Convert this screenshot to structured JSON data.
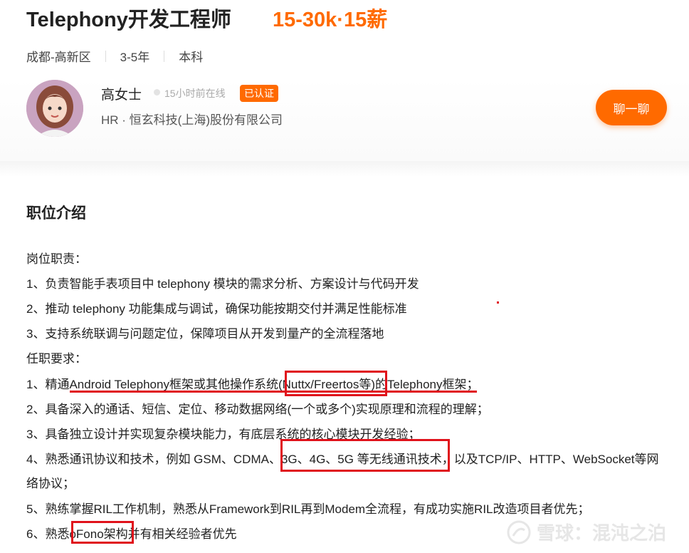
{
  "job": {
    "title": "Telephony开发工程师",
    "salary": "15-30k·15薪",
    "location": "成都-高新区",
    "experience": "3-5年",
    "education": "本科"
  },
  "recruiter": {
    "name": "高女士",
    "online_status": "15小时前在线",
    "verified_badge": "已认证",
    "company": "HR · 恒玄科技(上海)股份有限公司",
    "chat_button": "聊一聊"
  },
  "description": {
    "section_title": "职位介绍",
    "lines": [
      "岗位职责：",
      "1、负责智能手表项目中 telephony 模块的需求分析、方案设计与代码开发",
      "2、推动 telephony 功能集成与调试，确保功能按期交付并满足性能标准",
      "3、支持系统联调与问题定位，保障项目从开发到量产的全流程落地",
      "任职要求：",
      "1、精通Android Telephony框架或其他操作系统(Nuttx/Freertos等)的Telephony框架；",
      "2、具备深入的通话、短信、定位、移动数据网络(一个或多个)实现原理和流程的理解；",
      "3、具备独立设计并实现复杂模块能力，有底层系统的核心模块开发经验；",
      "4、熟悉通讯协议和技术，例如 GSM、CDMA、3G、4G、5G 等无线通讯技术，以及TCP/IP、HTTP、WebSocket等网",
      "络协议；",
      "5、熟练掌握RIL工作机制，熟悉从Framework到RIL再到Modem全流程，有成功实施RIL改造项目者优先；",
      "6、熟悉oFono架构并有相关经验者优先"
    ]
  },
  "watermark": {
    "text": "雪球：混沌之泊",
    "icon": "snowball-logo-icon"
  },
  "colors": {
    "accent": "#ff6a00",
    "annotation_red": "#e0121b"
  }
}
